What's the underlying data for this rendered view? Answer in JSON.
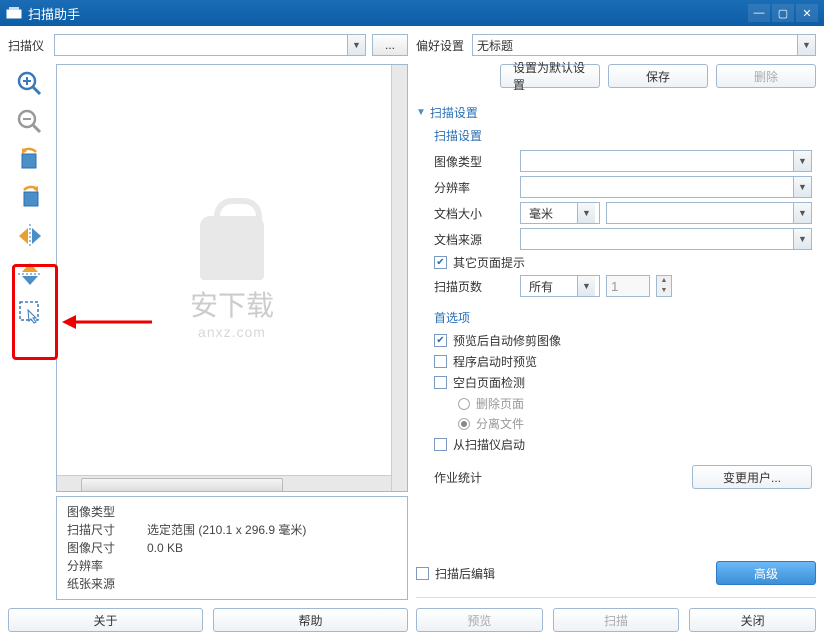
{
  "title": "扫描助手",
  "scanner": {
    "label": "扫描仪",
    "value": "",
    "browse": "..."
  },
  "info": {
    "type_label": "图像类型",
    "scan_size_label": "扫描尺寸",
    "scan_size_value": "选定范围 (210.1 x 296.9 毫米)",
    "image_size_label": "图像尺寸",
    "image_size_value": "0.0 KB",
    "resolution_label": "分辨率",
    "source_label": "纸张来源"
  },
  "left_buttons": {
    "about": "关于",
    "help": "帮助"
  },
  "pref": {
    "label": "偏好设置",
    "value": "无标题",
    "set_default": "设置为默认设置",
    "save": "保存",
    "delete": "删除"
  },
  "scan_settings": {
    "header": "扫描设置",
    "sub_header": "扫描设置",
    "image_type": "图像类型",
    "resolution": "分辨率",
    "doc_size": "文档大小",
    "doc_size_unit": "毫米",
    "doc_source": "文档来源",
    "other_pages": "其它页面提示",
    "scan_pages": "扫描页数",
    "scan_pages_val": "所有",
    "scan_pages_num": "1"
  },
  "options": {
    "header": "首选项",
    "auto_crop": "预览后自动修剪图像",
    "preview_on_start": "程序启动时预览",
    "blank_detect": "空白页面检测",
    "blank_delete": "删除页面",
    "blank_split": "分离文件",
    "start_from_scanner": "从扫描仪启动"
  },
  "stats": {
    "label": "作业统计",
    "change_user": "变更用户..."
  },
  "edit_after_scan": "扫描后编辑",
  "advanced": "高级",
  "bottom_buttons": {
    "preview": "预览",
    "scan": "扫描",
    "close": "关闭"
  },
  "watermark": {
    "text": "安下载",
    "url": "anxz.com"
  }
}
